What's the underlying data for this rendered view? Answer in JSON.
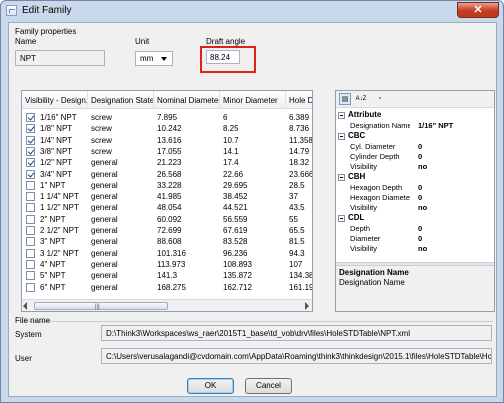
{
  "window": {
    "title": "Edit Family",
    "close_glyph": "✕"
  },
  "family_properties": {
    "section_label": "Family properties",
    "name_label": "Name",
    "name_value": "NPT",
    "unit_label": "Unit",
    "unit_value": "mm",
    "draft_angle_label": "Draft angle",
    "draft_angle_value": "88.24",
    "highlight_color": "#e0201a"
  },
  "grid": {
    "columns": [
      "Visibility - Design...",
      "Designation State",
      "Nominal Diameter",
      "Minor Diameter",
      "Hole D"
    ],
    "rows": [
      {
        "checked": true,
        "designation": "1/16\" NPT",
        "state": "screw",
        "nominal": "7.895",
        "minor": "6",
        "hole": "6.389"
      },
      {
        "checked": true,
        "designation": "1/8\" NPT",
        "state": "screw",
        "nominal": "10.242",
        "minor": "8.25",
        "hole": "8.736"
      },
      {
        "checked": true,
        "designation": "1/4\" NPT",
        "state": "screw",
        "nominal": "13.616",
        "minor": "10.7",
        "hole": "11.358"
      },
      {
        "checked": true,
        "designation": "3/8\" NPT",
        "state": "screw",
        "nominal": "17.055",
        "minor": "14.1",
        "hole": "14.79"
      },
      {
        "checked": true,
        "designation": "1/2\" NPT",
        "state": "general",
        "nominal": "21.223",
        "minor": "17.4",
        "hole": "18.32"
      },
      {
        "checked": true,
        "designation": "3/4\" NPT",
        "state": "general",
        "nominal": "26.568",
        "minor": "22.66",
        "hole": "23.666"
      },
      {
        "checked": false,
        "designation": "1\" NPT",
        "state": "general",
        "nominal": "33.228",
        "minor": "29.695",
        "hole": "28.5"
      },
      {
        "checked": false,
        "designation": "1 1/4\" NPT",
        "state": "general",
        "nominal": "41.985",
        "minor": "38.452",
        "hole": "37"
      },
      {
        "checked": false,
        "designation": "1 1/2\" NPT",
        "state": "general",
        "nominal": "48.054",
        "minor": "44.521",
        "hole": "43.5"
      },
      {
        "checked": false,
        "designation": "2\" NPT",
        "state": "general",
        "nominal": "60.092",
        "minor": "56.559",
        "hole": "55"
      },
      {
        "checked": false,
        "designation": "2 1/2\" NPT",
        "state": "general",
        "nominal": "72.699",
        "minor": "67.619",
        "hole": "65.5"
      },
      {
        "checked": false,
        "designation": "3\" NPT",
        "state": "general",
        "nominal": "88.608",
        "minor": "83.528",
        "hole": "81.5"
      },
      {
        "checked": false,
        "designation": "3 1/2\" NPT",
        "state": "general",
        "nominal": "101.316",
        "minor": "96.236",
        "hole": "94.3"
      },
      {
        "checked": false,
        "designation": "4\" NPT",
        "state": "general",
        "nominal": "113.973",
        "minor": "108.893",
        "hole": "107"
      },
      {
        "checked": false,
        "designation": "5\" NPT",
        "state": "general",
        "nominal": "141.3",
        "minor": "135.872",
        "hole": "134.38"
      },
      {
        "checked": false,
        "designation": "6\" NPT",
        "state": "general",
        "nominal": "168.275",
        "minor": "162.712",
        "hole": "161.19"
      }
    ],
    "scroll_grip": "|||"
  },
  "properties_panel": {
    "toolbar": {
      "categorized": "▤",
      "alphabetical": "A↓Z",
      "pages": "▫"
    },
    "categories": [
      {
        "name": "Attribute",
        "props": [
          {
            "name": "Designation Name",
            "value": "1/16\" NPT"
          }
        ]
      },
      {
        "name": "CBC",
        "props": [
          {
            "name": "Cyl. Diameter",
            "value": "0"
          },
          {
            "name": "Cylinder Depth",
            "value": "0"
          },
          {
            "name": "Visibility",
            "value": "no"
          }
        ]
      },
      {
        "name": "CBH",
        "props": [
          {
            "name": "Hexagon Depth",
            "value": "0"
          },
          {
            "name": "Hexagon Diameter",
            "value": "0"
          },
          {
            "name": "Visibility",
            "value": "no"
          }
        ]
      },
      {
        "name": "CDL",
        "props": [
          {
            "name": "Depth",
            "value": "0"
          },
          {
            "name": "Diameter",
            "value": "0"
          },
          {
            "name": "Visibility",
            "value": "no"
          }
        ]
      }
    ],
    "description_title": "Designation Name",
    "description_text": "Designation Name"
  },
  "file_name": {
    "section_label": "File name",
    "system_label": "System",
    "system_path": "D:\\Think3\\Workspaces\\ws_raer\\2015T1_base\\td_vob\\drv\\files\\HoleSTDTable\\NPT.xml",
    "user_label": "User",
    "user_path": "C:\\Users\\verusalagandi@cvdomain.com\\AppData\\Roaming\\think3\\thinkdesign\\2015.1\\files\\HoleSTDTable\\HoleSTD"
  },
  "buttons": {
    "ok": "OK",
    "cancel": "Cancel"
  }
}
